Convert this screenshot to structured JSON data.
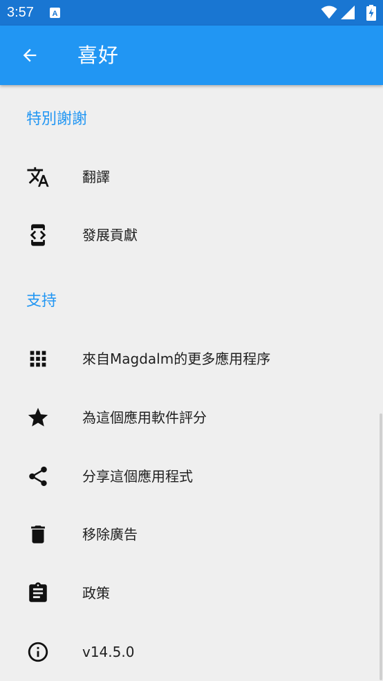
{
  "status_bar": {
    "time": "3:57",
    "icons": [
      "text-notification-icon",
      "wifi-icon",
      "cellular-signal-icon",
      "battery-charging-icon"
    ]
  },
  "app_bar": {
    "title": "喜好",
    "back_icon": "arrow-back-icon",
    "color": "#2196f3"
  },
  "sections": {
    "thanks": {
      "header": "特別謝謝",
      "items": [
        {
          "label": "翻譯",
          "icon": "translate-icon"
        },
        {
          "label": "發展貢獻",
          "icon": "developer-mode-icon"
        }
      ]
    },
    "support": {
      "header": "支持",
      "items": [
        {
          "label": "來自Magdalm的更多應用程序",
          "icon": "apps-grid-icon"
        },
        {
          "label": "為這個應用軟件評分",
          "icon": "star-icon"
        },
        {
          "label": "分享這個應用程式",
          "icon": "share-icon"
        },
        {
          "label": "移除廣告",
          "icon": "delete-icon"
        },
        {
          "label": "政策",
          "icon": "assignment-icon"
        },
        {
          "label": "v14.5.0",
          "icon": "info-icon"
        }
      ]
    }
  },
  "colors": {
    "status_bar": "#1976d2",
    "accent": "#2196f3",
    "background": "#efefef"
  }
}
